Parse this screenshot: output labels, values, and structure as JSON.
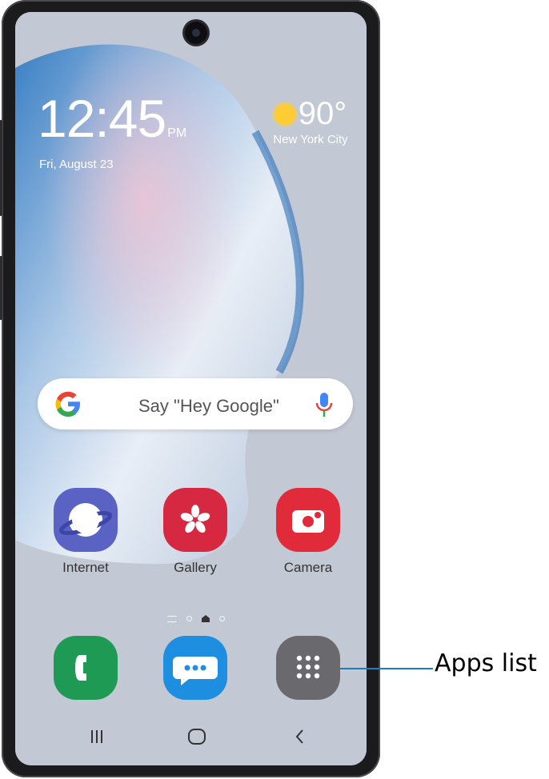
{
  "lockscreen": {
    "time": "12:45",
    "ampm": "PM",
    "date": "Fri, August 23"
  },
  "weather": {
    "temperature": "90°",
    "city": "New York City",
    "icon": "sun-icon"
  },
  "search": {
    "placeholder": "Say \"Hey Google\"",
    "left_icon": "google-g-icon",
    "right_icon": "microphone-icon"
  },
  "apps": [
    {
      "label": "Internet",
      "icon": "samsung-internet-icon",
      "color": "#5a63c4"
    },
    {
      "label": "Gallery",
      "icon": "gallery-flower-icon",
      "color": "#d62841"
    },
    {
      "label": "Camera",
      "icon": "camera-icon",
      "color": "#e12a3a"
    }
  ],
  "dock": [
    {
      "icon": "phone-icon",
      "color": "#1e9a55"
    },
    {
      "icon": "messages-icon",
      "color": "#1e8ee0"
    },
    {
      "icon": "apps-grid-icon",
      "color": "#6a6a6e"
    }
  ],
  "page_indicator": {
    "pages": 3,
    "current": 2
  },
  "navbar": {
    "recents": "recents-icon",
    "home": "home-icon",
    "back": "back-icon"
  },
  "callout": {
    "label": "Apps list",
    "color": "#1a7fc0"
  }
}
